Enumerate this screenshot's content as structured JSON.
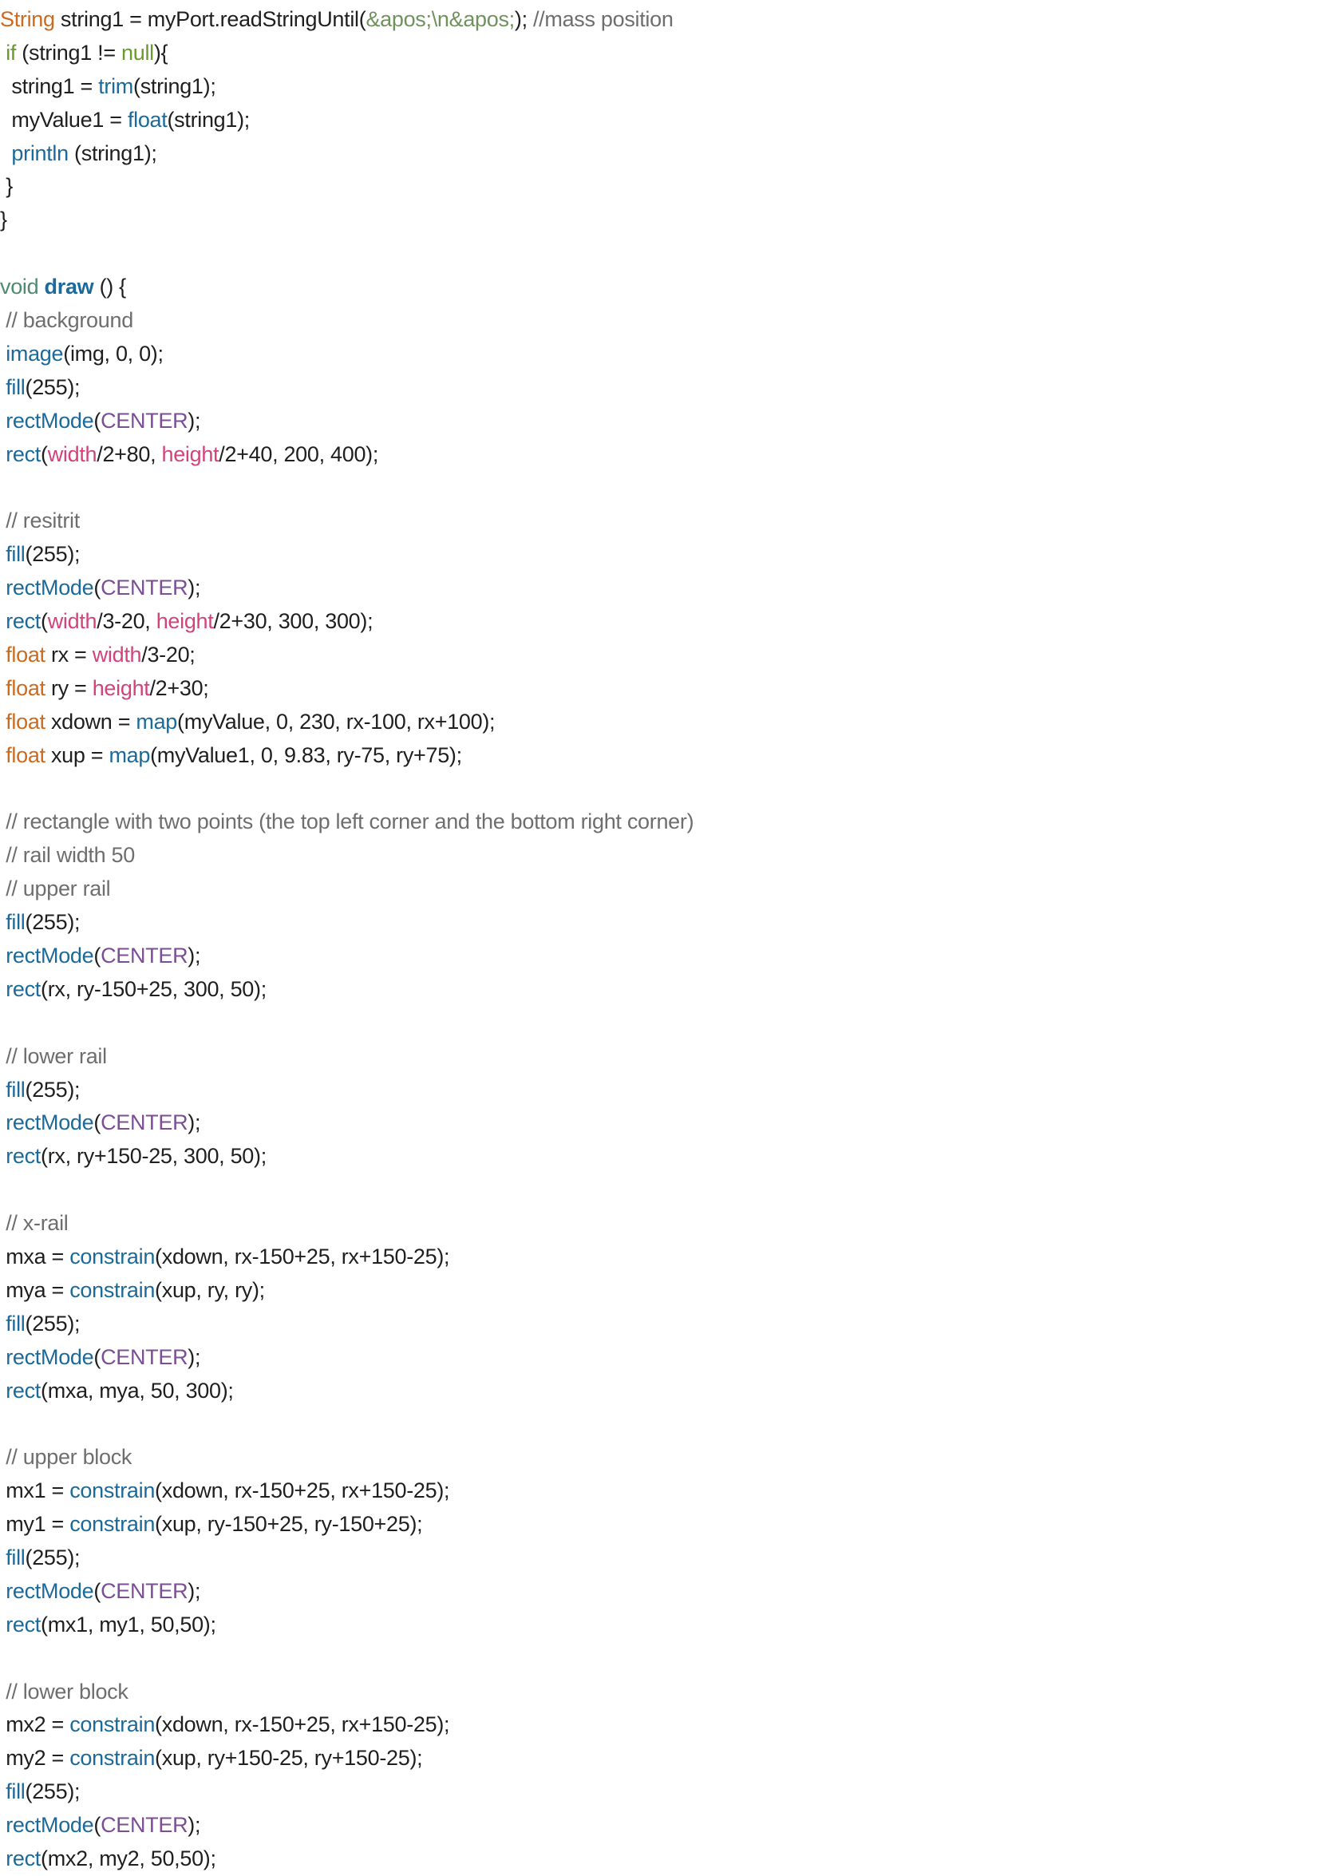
{
  "code_lines": [
    [
      [
        "keyword",
        "String"
      ],
      [
        "plain",
        " string1 = myPort.readStringUntil("
      ],
      [
        "string",
        "&apos;\\n&apos;"
      ],
      [
        "plain",
        "); "
      ],
      [
        "comment",
        "//mass position"
      ]
    ],
    [
      [
        "plain",
        " "
      ],
      [
        "builtin",
        "if"
      ],
      [
        "plain",
        " (string1 != "
      ],
      [
        "builtin",
        "null"
      ],
      [
        "plain",
        "){"
      ]
    ],
    [
      [
        "plain",
        "  string1 = "
      ],
      [
        "func",
        "trim"
      ],
      [
        "plain",
        "(string1);"
      ]
    ],
    [
      [
        "plain",
        "  myValue1 = "
      ],
      [
        "func",
        "float"
      ],
      [
        "plain",
        "(string1);"
      ]
    ],
    [
      [
        "plain",
        "  "
      ],
      [
        "func",
        "println"
      ],
      [
        "plain",
        " (string1);"
      ]
    ],
    [
      [
        "plain",
        " }"
      ]
    ],
    [
      [
        "plain",
        "}"
      ]
    ],
    [],
    [
      [
        "type",
        "void"
      ],
      [
        "plain",
        " "
      ],
      [
        "funcdef",
        "draw"
      ],
      [
        "plain",
        " () {"
      ]
    ],
    [
      [
        "plain",
        " "
      ],
      [
        "comment",
        "// background"
      ]
    ],
    [
      [
        "plain",
        " "
      ],
      [
        "func",
        "image"
      ],
      [
        "plain",
        "(img, 0, 0);"
      ]
    ],
    [
      [
        "plain",
        " "
      ],
      [
        "func",
        "fill"
      ],
      [
        "plain",
        "(255);"
      ]
    ],
    [
      [
        "plain",
        " "
      ],
      [
        "func",
        "rectMode"
      ],
      [
        "plain",
        "("
      ],
      [
        "const",
        "CENTER"
      ],
      [
        "plain",
        ");"
      ]
    ],
    [
      [
        "plain",
        " "
      ],
      [
        "func",
        "rect"
      ],
      [
        "plain",
        "("
      ],
      [
        "var",
        "width"
      ],
      [
        "plain",
        "/2+80, "
      ],
      [
        "var",
        "height"
      ],
      [
        "plain",
        "/2+40, 200, 400);"
      ]
    ],
    [],
    [
      [
        "plain",
        " "
      ],
      [
        "comment",
        "// resitrit"
      ]
    ],
    [
      [
        "plain",
        " "
      ],
      [
        "func",
        "fill"
      ],
      [
        "plain",
        "(255);"
      ]
    ],
    [
      [
        "plain",
        " "
      ],
      [
        "func",
        "rectMode"
      ],
      [
        "plain",
        "("
      ],
      [
        "const",
        "CENTER"
      ],
      [
        "plain",
        ");"
      ]
    ],
    [
      [
        "plain",
        " "
      ],
      [
        "func",
        "rect"
      ],
      [
        "plain",
        "("
      ],
      [
        "var",
        "width"
      ],
      [
        "plain",
        "/3-20, "
      ],
      [
        "var",
        "height"
      ],
      [
        "plain",
        "/2+30, 300, 300);"
      ]
    ],
    [
      [
        "plain",
        " "
      ],
      [
        "keyword",
        "float"
      ],
      [
        "plain",
        " rx = "
      ],
      [
        "var",
        "width"
      ],
      [
        "plain",
        "/3-20;"
      ]
    ],
    [
      [
        "plain",
        " "
      ],
      [
        "keyword",
        "float"
      ],
      [
        "plain",
        " ry = "
      ],
      [
        "var",
        "height"
      ],
      [
        "plain",
        "/2+30;"
      ]
    ],
    [
      [
        "plain",
        " "
      ],
      [
        "keyword",
        "float"
      ],
      [
        "plain",
        " xdown = "
      ],
      [
        "func",
        "map"
      ],
      [
        "plain",
        "(myValue, 0, 230, rx-100, rx+100);"
      ]
    ],
    [
      [
        "plain",
        " "
      ],
      [
        "keyword",
        "float"
      ],
      [
        "plain",
        " xup = "
      ],
      [
        "func",
        "map"
      ],
      [
        "plain",
        "(myValue1, 0, 9.83, ry-75, ry+75);"
      ]
    ],
    [],
    [
      [
        "plain",
        " "
      ],
      [
        "comment",
        "// rectangle with two points (the top left corner and the bottom right corner)"
      ]
    ],
    [
      [
        "plain",
        " "
      ],
      [
        "comment",
        "// rail width 50"
      ]
    ],
    [
      [
        "plain",
        " "
      ],
      [
        "comment",
        "// upper rail"
      ]
    ],
    [
      [
        "plain",
        " "
      ],
      [
        "func",
        "fill"
      ],
      [
        "plain",
        "(255);"
      ]
    ],
    [
      [
        "plain",
        " "
      ],
      [
        "func",
        "rectMode"
      ],
      [
        "plain",
        "("
      ],
      [
        "const",
        "CENTER"
      ],
      [
        "plain",
        ");"
      ]
    ],
    [
      [
        "plain",
        " "
      ],
      [
        "func",
        "rect"
      ],
      [
        "plain",
        "(rx, ry-150+25, 300, 50);"
      ]
    ],
    [],
    [
      [
        "plain",
        " "
      ],
      [
        "comment",
        "// lower rail"
      ]
    ],
    [
      [
        "plain",
        " "
      ],
      [
        "func",
        "fill"
      ],
      [
        "plain",
        "(255);"
      ]
    ],
    [
      [
        "plain",
        " "
      ],
      [
        "func",
        "rectMode"
      ],
      [
        "plain",
        "("
      ],
      [
        "const",
        "CENTER"
      ],
      [
        "plain",
        ");"
      ]
    ],
    [
      [
        "plain",
        " "
      ],
      [
        "func",
        "rect"
      ],
      [
        "plain",
        "(rx, ry+150-25, 300, 50);"
      ]
    ],
    [],
    [
      [
        "plain",
        " "
      ],
      [
        "comment",
        "// x-rail"
      ]
    ],
    [
      [
        "plain",
        " mxa = "
      ],
      [
        "func",
        "constrain"
      ],
      [
        "plain",
        "(xdown, rx-150+25, rx+150-25);"
      ]
    ],
    [
      [
        "plain",
        " mya = "
      ],
      [
        "func",
        "constrain"
      ],
      [
        "plain",
        "(xup, ry, ry);"
      ]
    ],
    [
      [
        "plain",
        " "
      ],
      [
        "func",
        "fill"
      ],
      [
        "plain",
        "(255);"
      ]
    ],
    [
      [
        "plain",
        " "
      ],
      [
        "func",
        "rectMode"
      ],
      [
        "plain",
        "("
      ],
      [
        "const",
        "CENTER"
      ],
      [
        "plain",
        ");"
      ]
    ],
    [
      [
        "plain",
        " "
      ],
      [
        "func",
        "rect"
      ],
      [
        "plain",
        "(mxa, mya, 50, 300);"
      ]
    ],
    [],
    [
      [
        "plain",
        " "
      ],
      [
        "comment",
        "// upper block"
      ]
    ],
    [
      [
        "plain",
        " mx1 = "
      ],
      [
        "func",
        "constrain"
      ],
      [
        "plain",
        "(xdown, rx-150+25, rx+150-25);"
      ]
    ],
    [
      [
        "plain",
        " my1 = "
      ],
      [
        "func",
        "constrain"
      ],
      [
        "plain",
        "(xup, ry-150+25, ry-150+25);"
      ]
    ],
    [
      [
        "plain",
        " "
      ],
      [
        "func",
        "fill"
      ],
      [
        "plain",
        "(255);"
      ]
    ],
    [
      [
        "plain",
        " "
      ],
      [
        "func",
        "rectMode"
      ],
      [
        "plain",
        "("
      ],
      [
        "const",
        "CENTER"
      ],
      [
        "plain",
        ");"
      ]
    ],
    [
      [
        "plain",
        " "
      ],
      [
        "func",
        "rect"
      ],
      [
        "plain",
        "(mx1, my1, 50,50);"
      ]
    ],
    [],
    [
      [
        "plain",
        " "
      ],
      [
        "comment",
        "// lower block"
      ]
    ],
    [
      [
        "plain",
        " mx2 = "
      ],
      [
        "func",
        "constrain"
      ],
      [
        "plain",
        "(xdown, rx-150+25, rx+150-25);"
      ]
    ],
    [
      [
        "plain",
        " my2 = "
      ],
      [
        "func",
        "constrain"
      ],
      [
        "plain",
        "(xup, ry+150-25, ry+150-25);"
      ]
    ],
    [
      [
        "plain",
        " "
      ],
      [
        "func",
        "fill"
      ],
      [
        "plain",
        "(255);"
      ]
    ],
    [
      [
        "plain",
        " "
      ],
      [
        "func",
        "rectMode"
      ],
      [
        "plain",
        "("
      ],
      [
        "const",
        "CENTER"
      ],
      [
        "plain",
        ");"
      ]
    ],
    [
      [
        "plain",
        " "
      ],
      [
        "func",
        "rect"
      ],
      [
        "plain",
        "(mx2, my2, 50,50);"
      ]
    ]
  ]
}
